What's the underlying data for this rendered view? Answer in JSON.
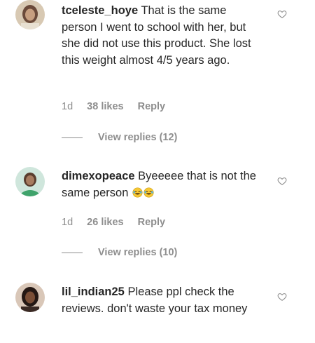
{
  "comments": [
    {
      "username": "tceleste_hoye",
      "text": "That is the same person I went to school with her, but she did not use this product. She lost this weight almost 4/5 years ago.",
      "time": "1d",
      "likes": "38 likes",
      "reply_label": "Reply",
      "view_replies": "View replies (12)",
      "avatar_icon": "profile-photo"
    },
    {
      "username": "dimexopeace",
      "text": "Byeeeee that is not the same person",
      "emojis": [
        "face-with-tears-of-joy",
        "face-with-tears-of-joy"
      ],
      "time": "1d",
      "likes": "26 likes",
      "reply_label": "Reply",
      "view_replies": "View replies (10)",
      "avatar_icon": "profile-photo"
    },
    {
      "username": "lil_indian25",
      "text": "Please ppl check the reviews. don't waste your tax money",
      "avatar_icon": "profile-photo"
    }
  ],
  "icons": {
    "like": "heart-outline-icon"
  },
  "colors": {
    "text": "#262626",
    "secondary": "#8e8e8e",
    "background": "#ffffff"
  }
}
